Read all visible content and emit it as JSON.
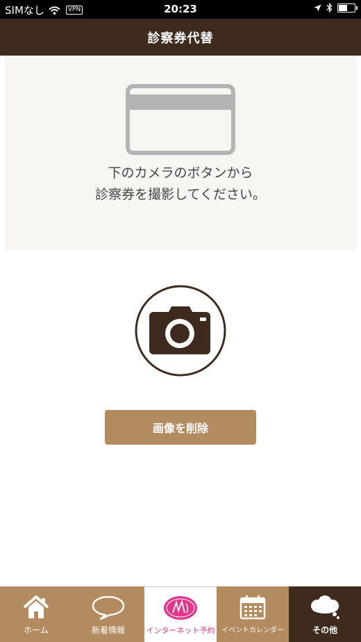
{
  "status_bar": {
    "carrier": "SIMなし",
    "vpn": "VPN",
    "time": "20:23",
    "battery_level": 0.55
  },
  "header": {
    "title": "診察券代替"
  },
  "instruction": {
    "line1": "下のカメラのボタンから",
    "line2": "診察券を撮影してください。"
  },
  "actions": {
    "delete_label": "画像を削除"
  },
  "tabs": [
    {
      "label": "ホーム",
      "icon": "home-icon"
    },
    {
      "label": "新着情報",
      "icon": "speech-bubble-icon"
    },
    {
      "label": "インターネット予約",
      "icon": "logo-icon"
    },
    {
      "label": "イベントカレンダー",
      "icon": "calendar-icon"
    },
    {
      "label": "その他",
      "icon": "thought-bubble-icon"
    }
  ],
  "colors": {
    "header": "#3f2a1e",
    "accent": "#b38b5f",
    "panel": "#f7f5f0",
    "active_label": "#e0378a"
  }
}
